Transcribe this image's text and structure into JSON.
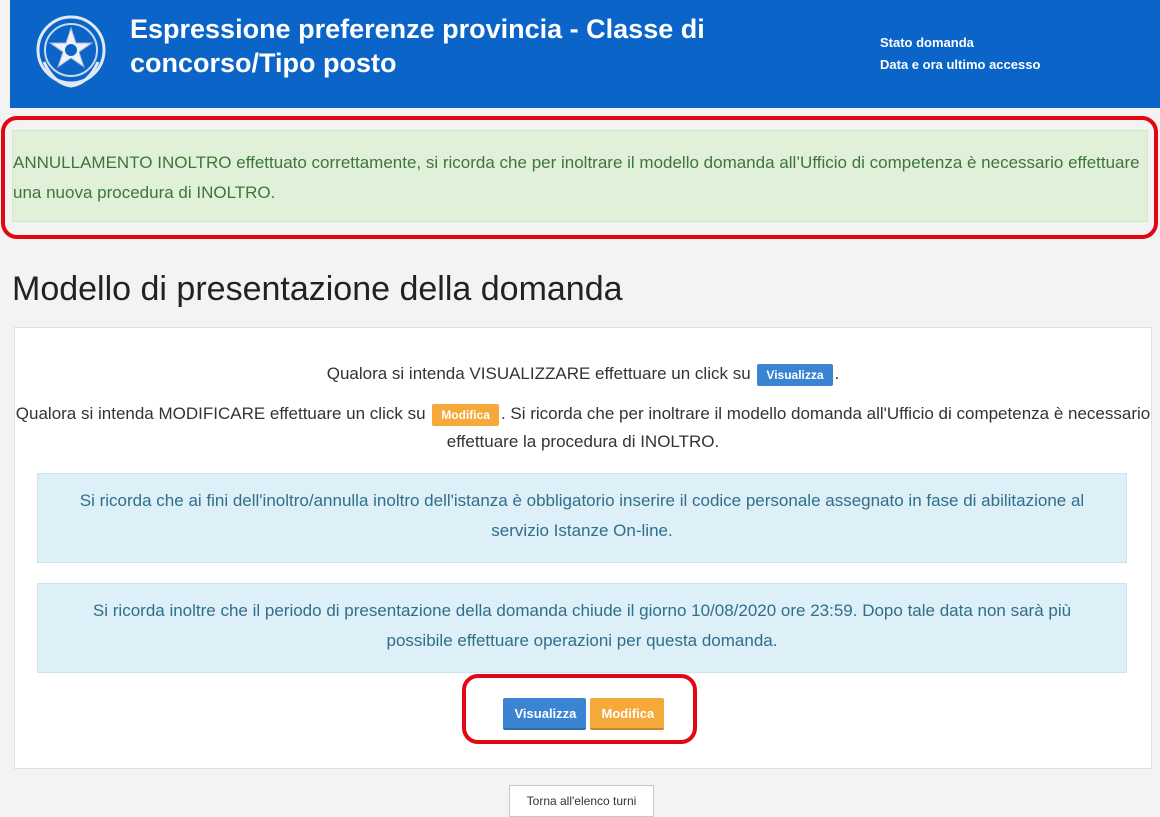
{
  "header": {
    "title_line1": "Espressione preferenze provincia - Classe di",
    "title_line2": "concorso/Tipo posto",
    "stato_domanda_label": "Stato domanda",
    "ultimo_accesso_label": "Data e ora ultimo accesso"
  },
  "alert": {
    "message": "ANNULLAMENTO INOLTRO effettuato correttamente, si ricorda che per inoltrare il modello domanda all’Ufficio di competenza è necessario effettuare una nuova procedura di INOLTRO."
  },
  "page": {
    "title": "Modello di presentazione della domanda"
  },
  "instructions": {
    "visualizza_prefix": "Qualora si intenda VISUALIZZARE effettuare un click su",
    "visualizza_suffix": ".",
    "modifica_prefix": "Qualora si intenda MODIFICARE effettuare un click su",
    "modifica_suffix": ". Si ricorda che per inoltrare il modello domanda all'Ufficio di competenza è necessario effettuare la procedura di INOLTRO.",
    "inline_visualizza": "Visualizza",
    "inline_modifica": "Modifica"
  },
  "info": {
    "codice_personale": "Si ricorda che ai fini dell'inoltro/annulla inoltro dell'istanza è obbligatorio inserire il codice personale assegnato in fase di abilitazione al servizio Istanze On-line.",
    "scadenza": "Si ricorda inoltre che il periodo di presentazione della domanda chiude il giorno 10/08/2020 ore 23:59. Dopo tale data non sarà più possibile effettuare operazioni per questa domanda."
  },
  "actions": {
    "visualizza": "Visualizza",
    "modifica": "Modifica",
    "back": "Torna all'elenco turni"
  },
  "colors": {
    "header_bg": "#0b64c8",
    "success_bg": "#e1f0d8",
    "info_bg": "#ddeff7",
    "btn_blue": "#3b84d1",
    "btn_orange": "#f5a93a",
    "highlight_red": "#e30613"
  },
  "icons": {
    "emblem": "italian-republic-emblem-icon"
  }
}
